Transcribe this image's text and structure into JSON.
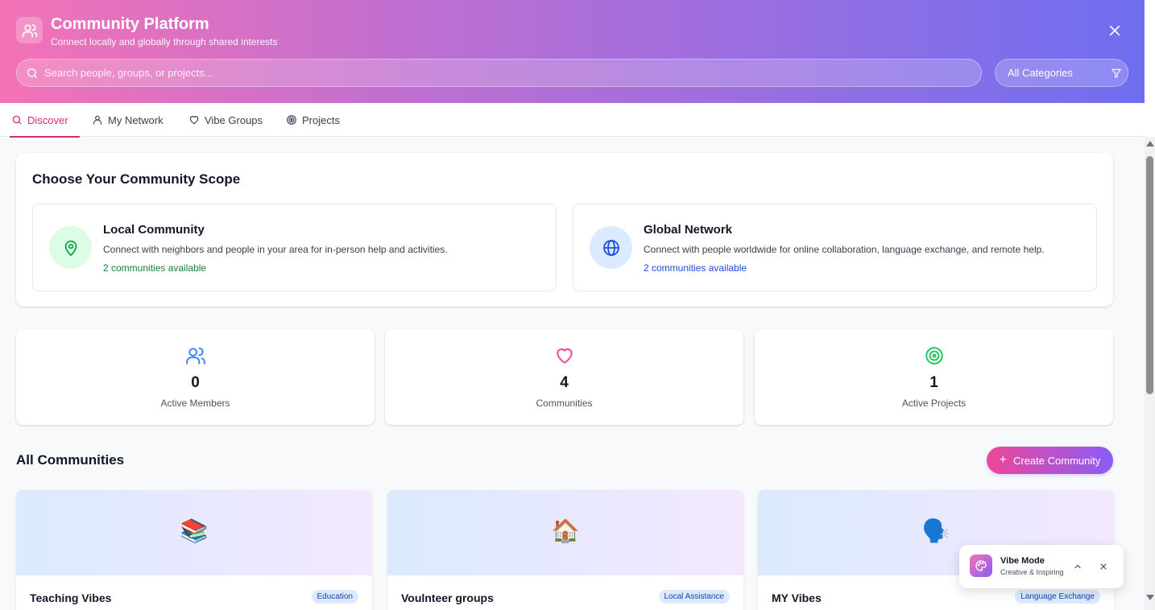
{
  "header": {
    "title": "Community Platform",
    "subtitle": "Connect locally and globally through shared interests",
    "search_placeholder": "Search people, groups, or projects...",
    "category_label": "All Categories"
  },
  "tabs": [
    {
      "label": "Discover",
      "icon": "search-icon",
      "active": true
    },
    {
      "label": "My Network",
      "icon": "user-icon",
      "active": false
    },
    {
      "label": "Vibe Groups",
      "icon": "heart-icon",
      "active": false
    },
    {
      "label": "Projects",
      "icon": "target-icon",
      "active": false
    }
  ],
  "scope": {
    "title": "Choose Your Community Scope",
    "local": {
      "title": "Local Community",
      "description": "Connect with neighbors and people in your area for in-person help and activities.",
      "count": "2 communities available",
      "icon": "map-pin-icon",
      "color": "#16a34a"
    },
    "global": {
      "title": "Global Network",
      "description": "Connect with people worldwide for online collaboration, language exchange, and remote help.",
      "count": "2 communities available",
      "icon": "globe-icon",
      "color": "#1d4ed8"
    }
  },
  "stats": [
    {
      "value": "0",
      "label": "Active Members",
      "icon": "users-icon",
      "color": "#3b82f6"
    },
    {
      "value": "4",
      "label": "Communities",
      "icon": "heart-icon",
      "color": "#ec4899"
    },
    {
      "value": "1",
      "label": "Active Projects",
      "icon": "target-icon",
      "color": "#22c55e"
    }
  ],
  "communities_section": {
    "title": "All Communities",
    "create_label": "Create Community"
  },
  "communities": [
    {
      "name": "Teaching Vibes",
      "tag": "Education",
      "emoji": "📚"
    },
    {
      "name": "Voulnteer groups",
      "tag": "Local Assistance",
      "emoji": "🏠"
    },
    {
      "name": "MY Vibes",
      "tag": "Language Exchange",
      "emoji": "🗣️"
    }
  ],
  "vibe_mode": {
    "title": "Vibe Mode",
    "subtitle": "Creative & Inspiring",
    "icon": "palette-icon"
  },
  "colors": {
    "accent": "#db2777",
    "header_start": "#f472b6",
    "header_end": "#6f6ef0"
  }
}
